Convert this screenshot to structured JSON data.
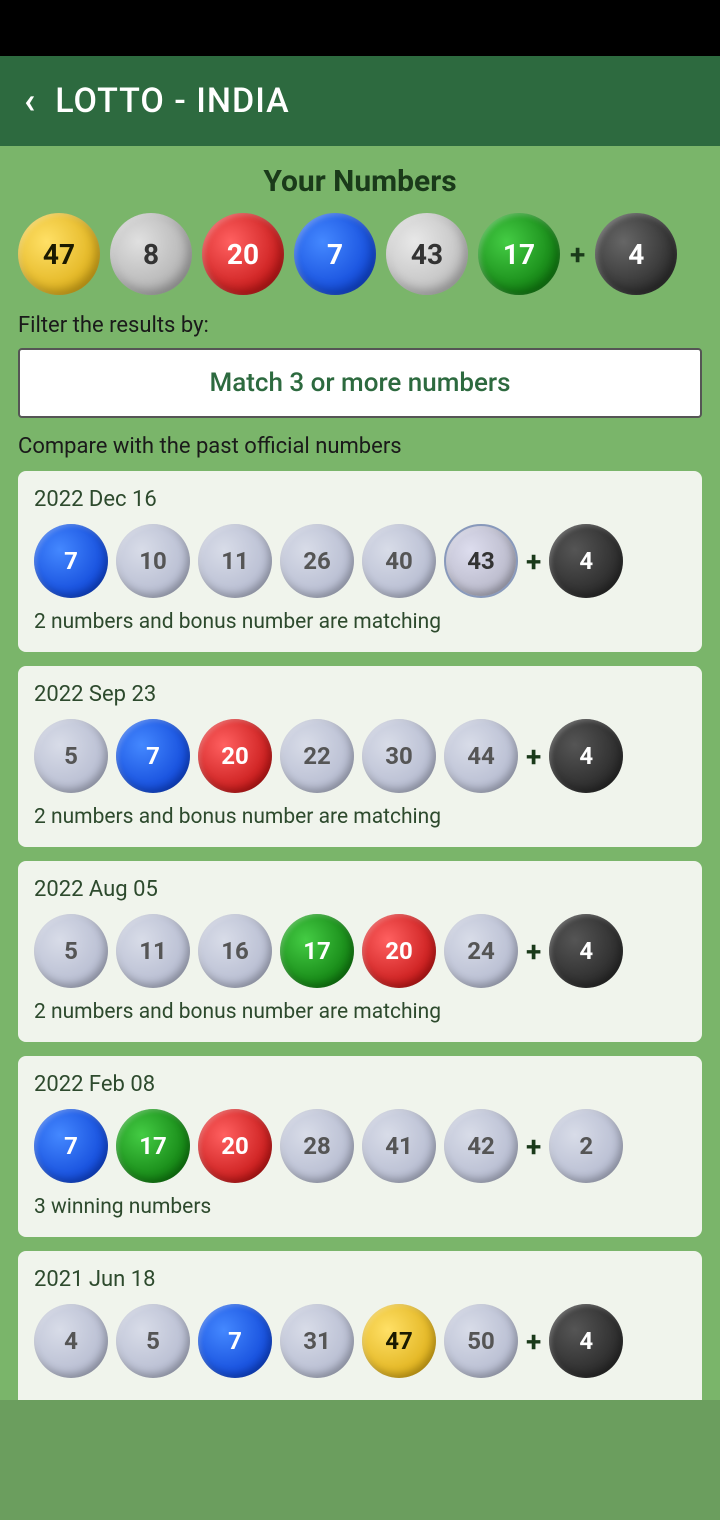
{
  "statusBar": {},
  "header": {
    "backLabel": "‹",
    "title": "LOTTO - INDIA"
  },
  "yourNumbers": {
    "label": "Your Numbers",
    "balls": [
      {
        "value": "47",
        "color": "yellow"
      },
      {
        "value": "8",
        "color": "gray"
      },
      {
        "value": "20",
        "color": "red"
      },
      {
        "value": "7",
        "color": "blue"
      },
      {
        "value": "43",
        "color": "light"
      },
      {
        "value": "17",
        "color": "green"
      }
    ],
    "bonus": {
      "value": "4",
      "color": "dark"
    }
  },
  "filter": {
    "label": "Filter the results by:",
    "value": "Match 3 or more numbers"
  },
  "compare": {
    "label": "Compare with the past official numbers"
  },
  "results": [
    {
      "date": "2022 Dec 16",
      "balls": [
        {
          "value": "7",
          "matched": true,
          "color": "match-blue"
        },
        {
          "value": "10",
          "matched": false
        },
        {
          "value": "11",
          "matched": false
        },
        {
          "value": "26",
          "matched": false
        },
        {
          "value": "40",
          "matched": false
        },
        {
          "value": "43",
          "matched": true,
          "color": "match-highlight"
        }
      ],
      "bonus": {
        "value": "4",
        "matched": true,
        "color": "dark-bonus"
      },
      "matchText": "2 numbers and bonus number are matching"
    },
    {
      "date": "2022 Sep 23",
      "balls": [
        {
          "value": "5",
          "matched": false
        },
        {
          "value": "7",
          "matched": true,
          "color": "match-blue"
        },
        {
          "value": "20",
          "matched": true,
          "color": "match-red"
        },
        {
          "value": "22",
          "matched": false
        },
        {
          "value": "30",
          "matched": false
        },
        {
          "value": "44",
          "matched": false
        }
      ],
      "bonus": {
        "value": "4",
        "matched": true,
        "color": "dark-bonus"
      },
      "matchText": "2 numbers and bonus number are matching"
    },
    {
      "date": "2022 Aug 05",
      "balls": [
        {
          "value": "5",
          "matched": false
        },
        {
          "value": "11",
          "matched": false
        },
        {
          "value": "16",
          "matched": false
        },
        {
          "value": "17",
          "matched": true,
          "color": "match-green"
        },
        {
          "value": "20",
          "matched": true,
          "color": "match-red"
        },
        {
          "value": "24",
          "matched": false
        }
      ],
      "bonus": {
        "value": "4",
        "matched": true,
        "color": "dark-bonus"
      },
      "matchText": "2 numbers and bonus number are matching"
    },
    {
      "date": "2022 Feb 08",
      "balls": [
        {
          "value": "7",
          "matched": true,
          "color": "match-blue"
        },
        {
          "value": "17",
          "matched": true,
          "color": "match-green"
        },
        {
          "value": "20",
          "matched": true,
          "color": "match-red"
        },
        {
          "value": "28",
          "matched": false
        },
        {
          "value": "41",
          "matched": false
        },
        {
          "value": "42",
          "matched": false
        }
      ],
      "bonus": {
        "value": "2",
        "matched": false
      },
      "matchText": "3 winning numbers",
      "winning": true
    },
    {
      "date": "2021 Jun 18",
      "balls": [
        {
          "value": "4",
          "matched": false
        },
        {
          "value": "5",
          "matched": false
        },
        {
          "value": "7",
          "matched": true,
          "color": "match-blue"
        },
        {
          "value": "31",
          "matched": false
        },
        {
          "value": "47",
          "matched": true,
          "color": "match-yellow"
        },
        {
          "value": "50",
          "matched": false
        }
      ],
      "bonus": {
        "value": "4",
        "matched": true,
        "color": "dark-bonus"
      },
      "matchText": "",
      "partial": true
    }
  ]
}
